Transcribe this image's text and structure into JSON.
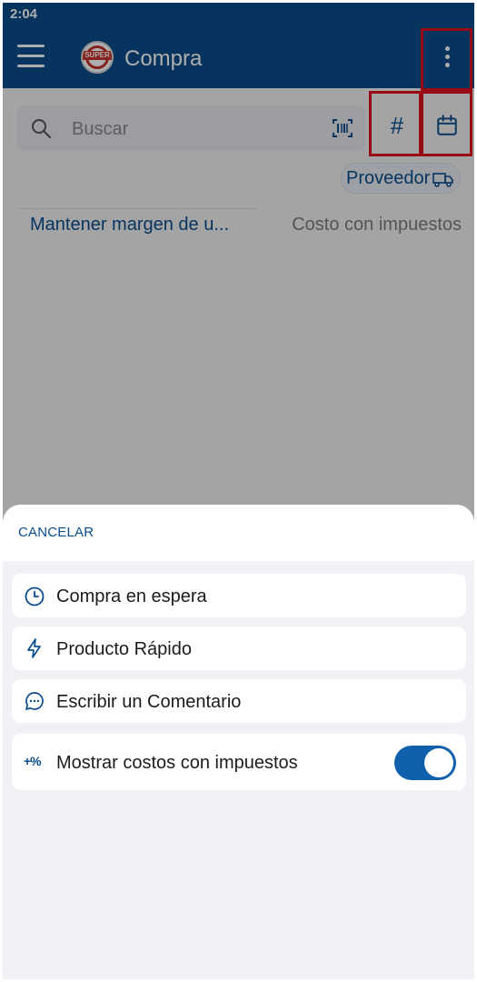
{
  "status_bar": {
    "time": "2:04"
  },
  "app_bar": {
    "title": "Compra",
    "logo_text": "SUPER"
  },
  "search": {
    "placeholder": "Buscar",
    "value": ""
  },
  "toolbar": {
    "hash_symbol": "#"
  },
  "filters": {
    "provider_chip": "Proveedor",
    "margin_link": "Mantener margen de u...",
    "cost_label": "Costo con impuestos"
  },
  "sheet": {
    "cancel_label": "CANCELAR",
    "options": [
      {
        "label": "Compra en espera",
        "icon": "clock-icon"
      },
      {
        "label": "Producto Rápido",
        "icon": "lightning-icon"
      },
      {
        "label": "Escribir un Comentario",
        "icon": "comment-icon"
      },
      {
        "label": "Mostrar costos con impuestos",
        "icon": "percent-icon",
        "icon_text": "+%",
        "toggle_on": true
      }
    ]
  },
  "colors": {
    "primary": "#0a4d8c",
    "highlight": "#e0101c",
    "toggle": "#1160ad",
    "sheet_bg": "#f2f2f6"
  }
}
